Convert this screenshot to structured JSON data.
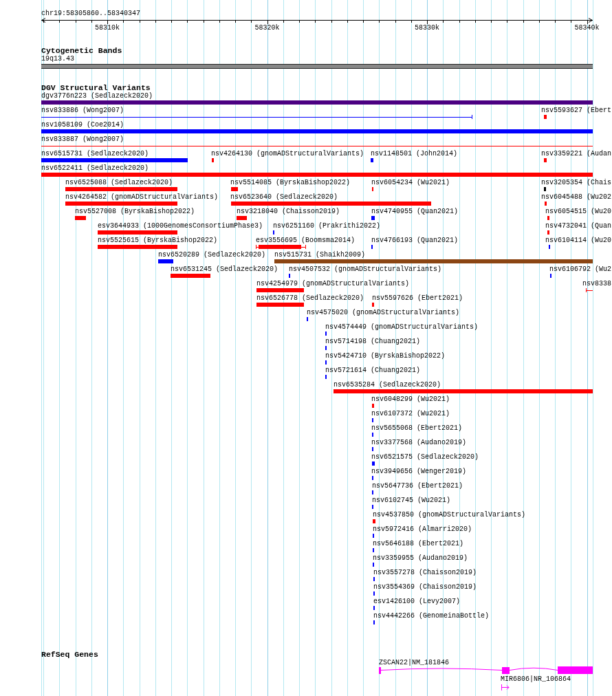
{
  "ruler": {
    "location": "chr19:58305860..58340347",
    "ticks": [
      "58310k",
      "58320k",
      "58330k",
      "58340k"
    ]
  },
  "tracks": [
    {
      "kind": "cytoband",
      "title": "Cytogenetic Bands",
      "band": "19q13.43"
    },
    {
      "kind": "variants",
      "title": "DGV Structural Variants",
      "rows": [
        {
          "features": [
            {
              "label": "dgv3776n223 (Sedlazeck2020)",
              "kind": "bar",
              "color": "#4b0082"
            }
          ]
        },
        {
          "features": [
            {
              "label": "nsv833886 (Wong2007)",
              "kind": "line",
              "color": "#0000ff"
            },
            {
              "label": "nsv5593627 (Ebert",
              "kind": "bar",
              "color": "#ff0000"
            }
          ]
        },
        {
          "features": [
            {
              "label": "nsv1058109 (Coe2014)",
              "kind": "bar",
              "color": "#0000ff"
            }
          ]
        },
        {
          "features": [
            {
              "label": "nsv833887 (Wong2007)",
              "kind": "line",
              "color": "#ff0000"
            }
          ]
        },
        {
          "features": [
            {
              "label": "nsv6515731 (Sedlazeck2020)",
              "kind": "bar",
              "color": "#0000ff"
            },
            {
              "label": "nsv4264130 (gnomADStructuralVariants)",
              "kind": "bar",
              "color": "#ff0000"
            },
            {
              "label": "nsv1148501 (John2014)",
              "kind": "bar",
              "color": "#0000ff"
            },
            {
              "label": "nsv3359221 (Audan",
              "kind": "bar",
              "color": "#ff0000"
            }
          ]
        },
        {
          "features": [
            {
              "label": "nsv6522411 (Sedlazeck2020)",
              "kind": "bar",
              "color": "#ff0000"
            }
          ]
        },
        {
          "features": [
            {
              "label": "nsv6525088 (Sedlazeck2020)",
              "kind": "bar",
              "color": "#ff0000"
            },
            {
              "label": "nsv5514085 (ByrskaBishop2022)",
              "kind": "bar",
              "color": "#ff0000"
            },
            {
              "label": "nsv6054234 (Wu2021)",
              "kind": "bar",
              "color": "#ff0000"
            },
            {
              "label": "nsv3205354 (Chais",
              "kind": "bar",
              "color": "#000000"
            }
          ]
        },
        {
          "features": [
            {
              "label": "nsv4264582 (gnomADStructuralVariants)",
              "kind": "bar",
              "color": "#ff0000"
            },
            {
              "label": "nsv6523640 (Sedlazeck2020)",
              "kind": "bar",
              "color": "#ff0000"
            },
            {
              "label": "nsv6045488 (Wu202",
              "kind": "bar",
              "color": "#ff0000"
            }
          ]
        },
        {
          "features": [
            {
              "label": "nsv5527008 (ByrskaBishop2022)",
              "kind": "bar",
              "color": "#ff0000"
            },
            {
              "label": "nsv3218040 (Chaisson2019)",
              "kind": "bar",
              "color": "#ff0000"
            },
            {
              "label": "nsv4740955 (Quan2021)",
              "kind": "bar",
              "color": "#0000ff"
            },
            {
              "label": "nsv6054515 (Wu20",
              "kind": "bar",
              "color": "#ff0000"
            }
          ]
        },
        {
          "features": [
            {
              "label": "esv3644933 (1000GenomesConsortiumPhase3)",
              "kind": "bar",
              "color": "#ff0000"
            },
            {
              "label": "nsv6251160 (Prakrithi2022)",
              "kind": "bar",
              "color": "#0000ff"
            },
            {
              "label": "nsv4732041 (Quan",
              "kind": "bar",
              "color": "#ff0000"
            }
          ]
        },
        {
          "features": [
            {
              "label": "nsv5525615 (ByrskaBishop2022)",
              "kind": "bar",
              "color": "#ff0000"
            },
            {
              "label": "esv3556695 (Boomsma2014)",
              "kind": "bracketed",
              "color": "#ff0000"
            },
            {
              "label": "nsv4766193 (Quan2021)",
              "kind": "bar",
              "color": "#0000ff"
            },
            {
              "label": "nsv6104114 (Wu20",
              "kind": "bar",
              "color": "#0000ff"
            }
          ]
        },
        {
          "features": [
            {
              "label": "nsv6520289 (Sedlazeck2020)",
              "kind": "bar",
              "color": "#0000ff"
            },
            {
              "label": "nsv515731 (Shaikh2009)",
              "kind": "bar",
              "color": "#8b4513"
            }
          ]
        },
        {
          "features": [
            {
              "label": "nsv6531245 (Sedlazeck2020)",
              "kind": "bar",
              "color": "#ff0000"
            },
            {
              "label": "nsv4507532 (gnomADStructuralVariants)",
              "kind": "bar",
              "color": "#0000ff"
            },
            {
              "label": "nsv6106792 (Wu2",
              "kind": "bar",
              "color": "#0000ff"
            }
          ]
        },
        {
          "features": [
            {
              "label": "nsv4254979 (gnomADStructuralVariants)",
              "kind": "bar",
              "color": "#ff0000"
            },
            {
              "label": "nsv8338",
              "kind": "line",
              "color": "#ff0000"
            }
          ]
        },
        {
          "features": [
            {
              "label": "nsv6526778 (Sedlazeck2020)",
              "kind": "bar",
              "color": "#ff0000"
            },
            {
              "label": "nsv5597626 (Ebert2021)",
              "kind": "bar",
              "color": "#ff0000"
            }
          ]
        },
        {
          "features": [
            {
              "label": "nsv4575020 (gnomADStructuralVariants)",
              "kind": "bar",
              "color": "#0000ff"
            }
          ]
        },
        {
          "features": [
            {
              "label": "nsv4574449 (gnomADStructuralVariants)",
              "kind": "bar",
              "color": "#0000ff"
            }
          ]
        },
        {
          "features": [
            {
              "label": "nsv5714198 (Chuang2021)",
              "kind": "bar",
              "color": "#0000ff"
            }
          ]
        },
        {
          "features": [
            {
              "label": "nsv5424710 (ByrskaBishop2022)",
              "kind": "bar",
              "color": "#0000ff"
            }
          ]
        },
        {
          "features": [
            {
              "label": "nsv5721614 (Chuang2021)",
              "kind": "bar",
              "color": "#0000ff"
            }
          ]
        },
        {
          "features": [
            {
              "label": "nsv6535284 (Sedlazeck2020)",
              "kind": "bar",
              "color": "#ff0000"
            }
          ]
        },
        {
          "features": [
            {
              "label": "nsv6048299 (Wu2021)",
              "kind": "bar",
              "color": "#ff0000"
            }
          ]
        },
        {
          "features": [
            {
              "label": "nsv6107372 (Wu2021)",
              "kind": "bar",
              "color": "#0000ff"
            }
          ]
        },
        {
          "features": [
            {
              "label": "nsv5655068 (Ebert2021)",
              "kind": "bar",
              "color": "#0000ff"
            }
          ]
        },
        {
          "features": [
            {
              "label": "nsv3377568 (Audano2019)",
              "kind": "bar",
              "color": "#0000ff"
            }
          ]
        },
        {
          "features": [
            {
              "label": "nsv6521575 (Sedlazeck2020)",
              "kind": "bar",
              "color": "#0000ff"
            }
          ]
        },
        {
          "features": [
            {
              "label": "nsv3949656 (Wenger2019)",
              "kind": "bar",
              "color": "#0000ff"
            }
          ]
        },
        {
          "features": [
            {
              "label": "nsv5647736 (Ebert2021)",
              "kind": "bar",
              "color": "#0000ff"
            }
          ]
        },
        {
          "features": [
            {
              "label": "nsv6102745 (Wu2021)",
              "kind": "bar",
              "color": "#0000ff"
            }
          ]
        },
        {
          "features": [
            {
              "label": "nsv4537850 (gnomADStructuralVariants)",
              "kind": "bar",
              "color": "#ff0000"
            }
          ]
        },
        {
          "features": [
            {
              "label": "nsv5972416 (Almarri2020)",
              "kind": "bar",
              "color": "#0000ff"
            }
          ]
        },
        {
          "features": [
            {
              "label": "nsv5646188 (Ebert2021)",
              "kind": "bar",
              "color": "#0000ff"
            }
          ]
        },
        {
          "features": [
            {
              "label": "nsv3359955 (Audano2019)",
              "kind": "bar",
              "color": "#0000ff"
            }
          ]
        },
        {
          "features": [
            {
              "label": "nsv3557278 (Chaisson2019)",
              "kind": "bar",
              "color": "#0000ff"
            }
          ]
        },
        {
          "features": [
            {
              "label": "nsv3554369 (Chaisson2019)",
              "kind": "bar",
              "color": "#0000ff"
            }
          ]
        },
        {
          "features": [
            {
              "label": "esv1426100 (Levy2007)",
              "kind": "bar",
              "color": "#0000ff"
            }
          ]
        },
        {
          "features": [
            {
              "label": "nsv4442266 (GenomeinaBottle)",
              "kind": "bar",
              "color": "#0000ff"
            }
          ]
        }
      ]
    },
    {
      "kind": "genes",
      "title": "RefSeq Genes",
      "genes": [
        {
          "label": "ZSCAN22|NM_181846",
          "kind": "transcript"
        },
        {
          "label": "MIR6806|NR_106864",
          "kind": "mirna"
        }
      ]
    }
  ]
}
